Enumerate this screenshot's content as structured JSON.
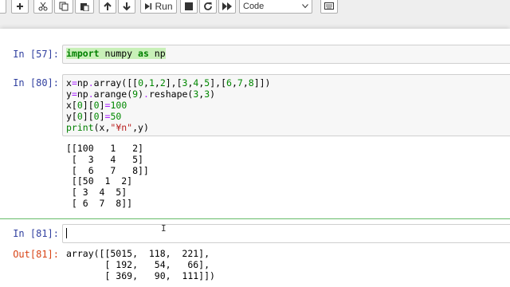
{
  "toolbar": {
    "run_label": "Run",
    "cell_type": "Code",
    "cell_type_options": [
      "Code"
    ]
  },
  "cells": [
    {
      "prompt": "In [57]:",
      "code_lines": [
        [
          {
            "t": "import",
            "c": "kw hl"
          },
          {
            "t": " numpy ",
            "c": "hl"
          },
          {
            "t": "as",
            "c": "kw hl"
          },
          {
            "t": " np",
            "c": "hl"
          }
        ]
      ]
    },
    {
      "prompt": "In [80]:",
      "code_lines": [
        [
          {
            "t": "x",
            "c": ""
          },
          {
            "t": "=",
            "c": "op"
          },
          {
            "t": "np",
            "c": ""
          },
          {
            "t": ".",
            "c": "op"
          },
          {
            "t": "array([[",
            "c": ""
          },
          {
            "t": "0",
            "c": "num"
          },
          {
            "t": ",",
            "c": ""
          },
          {
            "t": "1",
            "c": "num"
          },
          {
            "t": ",",
            "c": ""
          },
          {
            "t": "2",
            "c": "num"
          },
          {
            "t": "],[",
            "c": ""
          },
          {
            "t": "3",
            "c": "num"
          },
          {
            "t": ",",
            "c": ""
          },
          {
            "t": "4",
            "c": "num"
          },
          {
            "t": ",",
            "c": ""
          },
          {
            "t": "5",
            "c": "num"
          },
          {
            "t": "],[",
            "c": ""
          },
          {
            "t": "6",
            "c": "num"
          },
          {
            "t": ",",
            "c": ""
          },
          {
            "t": "7",
            "c": "num"
          },
          {
            "t": ",",
            "c": ""
          },
          {
            "t": "8",
            "c": "num"
          },
          {
            "t": "]])",
            "c": ""
          }
        ],
        [
          {
            "t": "y",
            "c": ""
          },
          {
            "t": "=",
            "c": "op"
          },
          {
            "t": "np",
            "c": ""
          },
          {
            "t": ".",
            "c": "op"
          },
          {
            "t": "arange(",
            "c": ""
          },
          {
            "t": "9",
            "c": "num"
          },
          {
            "t": ")",
            "c": ""
          },
          {
            "t": ".",
            "c": "op"
          },
          {
            "t": "reshape(",
            "c": ""
          },
          {
            "t": "3",
            "c": "num"
          },
          {
            "t": ",",
            "c": ""
          },
          {
            "t": "3",
            "c": "num"
          },
          {
            "t": ")",
            "c": ""
          }
        ],
        [
          {
            "t": "x[",
            "c": ""
          },
          {
            "t": "0",
            "c": "num"
          },
          {
            "t": "][",
            "c": ""
          },
          {
            "t": "0",
            "c": "num"
          },
          {
            "t": "]",
            "c": ""
          },
          {
            "t": "=",
            "c": "op"
          },
          {
            "t": "100",
            "c": "num"
          }
        ],
        [
          {
            "t": "y[",
            "c": ""
          },
          {
            "t": "0",
            "c": "num"
          },
          {
            "t": "][",
            "c": ""
          },
          {
            "t": "0",
            "c": "num"
          },
          {
            "t": "]",
            "c": ""
          },
          {
            "t": "=",
            "c": "op"
          },
          {
            "t": "50",
            "c": "num"
          }
        ],
        [
          {
            "t": "print",
            "c": "bi"
          },
          {
            "t": "(x,",
            "c": ""
          },
          {
            "t": "\"¥n\"",
            "c": "str"
          },
          {
            "t": ",y)",
            "c": ""
          }
        ]
      ],
      "output": "[[100   1   2]\n [  3   4   5]\n [  6   7   8]]\n [[50  1  2]\n [ 3  4  5]\n [ 6  7  8]]"
    },
    {
      "prompt": "In [81]:",
      "code_lines": [],
      "out_prompt": "Out[81]:",
      "output": "array([[5015,  118,  221],\n       [ 192,   54,   66],\n       [ 369,   90,  111]])"
    }
  ]
}
